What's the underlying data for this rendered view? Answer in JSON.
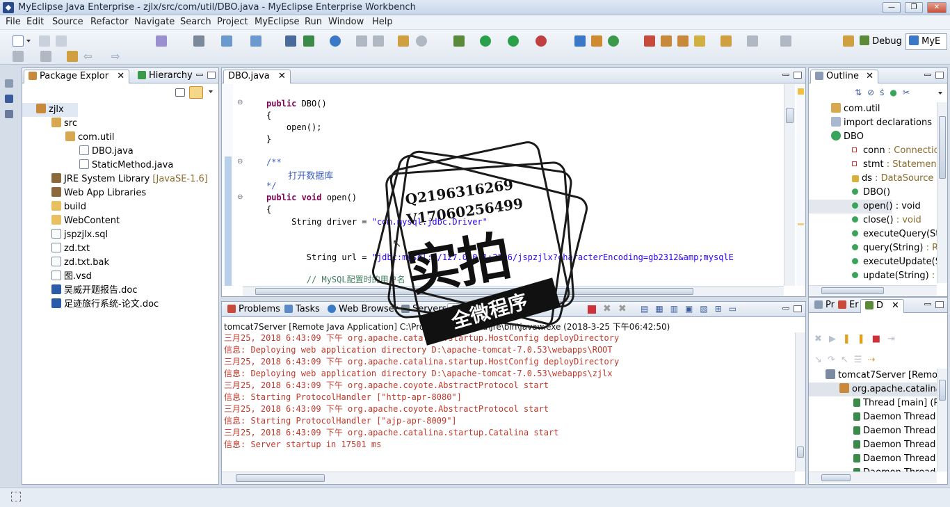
{
  "window": {
    "title": "MyEclipse Java Enterprise - zjlx/src/com/util/DBO.java - MyEclipse Enterprise Workbench",
    "controls": {
      "minimize": "—",
      "restore": "❐",
      "close": "✕"
    }
  },
  "menu": [
    "File",
    "Edit",
    "Source",
    "Refactor",
    "Navigate",
    "Search",
    "Project",
    "MyEclipse",
    "Run",
    "Window",
    "Help"
  ],
  "perspectives": {
    "debug": "Debug",
    "myeclipse": "MyE"
  },
  "package_explorer": {
    "tabs": [
      "Package Explor",
      "Hierarchy"
    ],
    "tree": [
      {
        "label": "zjlx",
        "indent": 0,
        "icon": "project-icon"
      },
      {
        "label": "src",
        "indent": 1,
        "icon": "source-folder-icon"
      },
      {
        "label": "com.util",
        "indent": 2,
        "icon": "package-icon"
      },
      {
        "label": "DBO.java",
        "indent": 3,
        "icon": "java-file-icon"
      },
      {
        "label": "StaticMethod.java",
        "indent": 3,
        "icon": "java-file-icon"
      },
      {
        "label": "JRE System Library",
        "suffix": "[JavaSE-1.6]",
        "indent": 1,
        "icon": "library-icon"
      },
      {
        "label": "Web App Libraries",
        "indent": 1,
        "icon": "library-icon"
      },
      {
        "label": "build",
        "indent": 1,
        "icon": "folder-icon"
      },
      {
        "label": "WebContent",
        "indent": 1,
        "icon": "folder-icon"
      },
      {
        "label": "jspzjlx.sql",
        "indent": 1,
        "icon": "file-icon"
      },
      {
        "label": "zd.txt",
        "indent": 1,
        "icon": "file-icon"
      },
      {
        "label": "zd.txt.bak",
        "indent": 1,
        "icon": "file-icon"
      },
      {
        "label": "图.vsd",
        "indent": 1,
        "icon": "file-icon"
      },
      {
        "label": "吴威开题报告.doc",
        "indent": 1,
        "icon": "word-doc-icon"
      },
      {
        "label": "足迹旅行系统-论文.doc",
        "indent": 1,
        "icon": "word-doc-icon"
      }
    ]
  },
  "editor": {
    "tab": "DBO.java",
    "lines": {
      "l1a": "public",
      "l1b": " DBO()",
      "l2": "{",
      "l3": "    open();",
      "l4": "}",
      "l5": "/**",
      "l6": "    打开数据库",
      "l7": "*/",
      "l8a": "public void",
      "l8b": " open()",
      "l9": "{",
      "l10a": "     String driver = ",
      "l10b": "\"com.mysql.jdbc.Driver\"",
      "l11a": "        String url = ",
      "l11b": "\"jdbc:mysql://127.0.0.1:3306/jspzjlx?characterEncoding=gb2312&amp;mysqlE",
      "l12": "        // MySQL配置时的用户名"
    }
  },
  "outline": {
    "tab": "Outline",
    "items": [
      {
        "label": "com.util",
        "type": "",
        "icon": "package-icon"
      },
      {
        "label": "import declarations",
        "type": "",
        "icon": "imports-icon"
      },
      {
        "label": "DBO",
        "type": "",
        "icon": "class-icon"
      },
      {
        "label": "conn",
        "type": " : Connectio",
        "icon": "private-field-icon"
      },
      {
        "label": "stmt",
        "type": " : Statement",
        "icon": "private-field-icon"
      },
      {
        "label": "ds",
        "type": " : DataSource",
        "icon": "field-icon"
      },
      {
        "label": "DBO()",
        "type": "",
        "icon": "constructor-icon"
      },
      {
        "label": "open() : void",
        "type": "",
        "icon": "method-icon"
      },
      {
        "label": "close()",
        "type": " : void",
        "icon": "method-icon"
      },
      {
        "label": "executeQuery(Str",
        "type": "",
        "icon": "method-icon"
      },
      {
        "label": "query(String)",
        "type": " : Re",
        "icon": "method-icon"
      },
      {
        "label": "executeUpdate(S",
        "type": "",
        "icon": "method-icon"
      },
      {
        "label": "update(String)",
        "type": " : i",
        "icon": "method-icon"
      }
    ]
  },
  "console": {
    "tabs": [
      "Problems",
      "Tasks",
      "Web Browser",
      "Servers",
      "Co"
    ],
    "header": "tomcat7Server [Remote Java Application] C:\\Program Files\\Java\\jre\\bin\\javaw.exe (2018-3-25 下午06:42:50)",
    "lines": [
      "三月25, 2018 6:43:09 下午 org.apache.catalina.startup.HostConfig deployDirectory",
      "信息: Deploying web application directory D:\\apache-tomcat-7.0.53\\webapps\\ROOT",
      "三月25, 2018 6:43:09 下午 org.apache.catalina.startup.HostConfig deployDirectory",
      "信息: Deploying web application directory D:\\apache-tomcat-7.0.53\\webapps\\zjlx",
      "三月25, 2018 6:43:09 下午 org.apache.coyote.AbstractProtocol start",
      "信息: Starting ProtocolHandler [\"http-apr-8080\"]",
      "三月25, 2018 6:43:09 下午 org.apache.coyote.AbstractProtocol start",
      "信息: Starting ProtocolHandler [\"ajp-apr-8009\"]",
      "三月25, 2018 6:43:09 下午 org.apache.catalina.startup.Catalina start",
      "信息: Server startup in 17501 ms"
    ]
  },
  "debug": {
    "tabs": [
      "Pr",
      "Er",
      "D"
    ],
    "tree": [
      {
        "label": "tomcat7Server [Remote",
        "indent": 0,
        "icon": "launch-icon"
      },
      {
        "label": "org.apache.catalina.",
        "indent": 1,
        "icon": "vm-icon"
      },
      {
        "label": "Thread [main] (R",
        "indent": 2,
        "icon": "thread-icon"
      },
      {
        "label": "Daemon Thread",
        "indent": 2,
        "icon": "thread-icon"
      },
      {
        "label": "Daemon Thread",
        "indent": 2,
        "icon": "thread-icon"
      },
      {
        "label": "Daemon Thread",
        "indent": 2,
        "icon": "thread-icon"
      },
      {
        "label": "Daemon Thread",
        "indent": 2,
        "icon": "thread-icon"
      },
      {
        "label": "Daemon Thread",
        "indent": 2,
        "icon": "thread-icon"
      }
    ]
  },
  "watermark": {
    "q": "Q2196316269",
    "v": "V17060256499",
    "big": "实拍",
    "banner": "全微程序"
  },
  "colors": {
    "accent": "#3a78c8",
    "console_text": "#c0392b",
    "keyword": "#7f0055",
    "string": "#2a00ff"
  }
}
